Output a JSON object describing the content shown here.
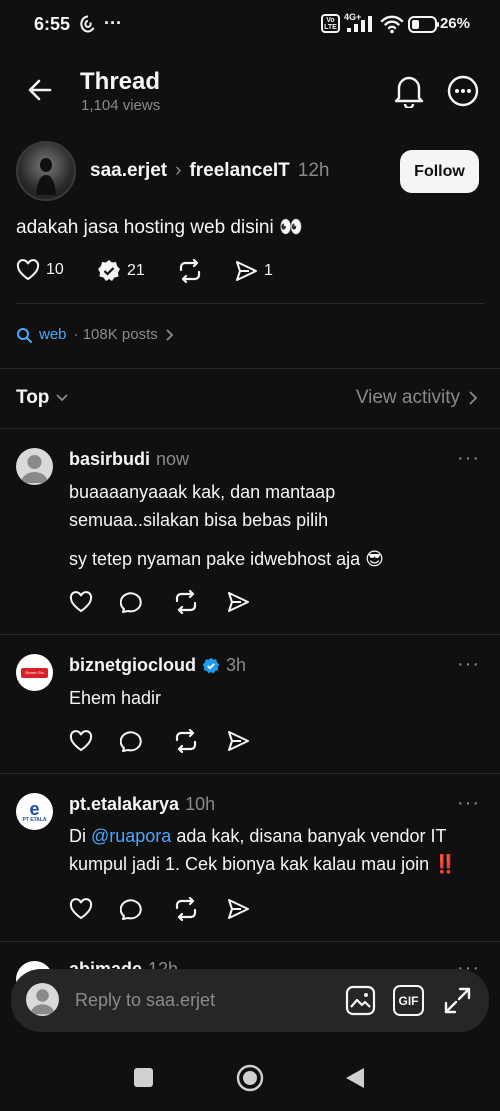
{
  "status_bar": {
    "time": "6:55",
    "network": "4G+",
    "battery": "26%"
  },
  "header": {
    "title": "Thread",
    "views": "1,104 views"
  },
  "post": {
    "author": "saa.erjet",
    "separator": "›",
    "topic": "freelanceIT",
    "time": "12h",
    "follow_label": "Follow",
    "text": "adakah jasa hosting web disini 👀",
    "likes": "10",
    "replies": "21",
    "shares": "1"
  },
  "topic_tag": {
    "name": "web",
    "posts": "· 108K posts"
  },
  "sort": {
    "label": "Top",
    "view_activity": "View activity"
  },
  "replies": [
    {
      "username": "basirbudi",
      "time": "now",
      "lines": [
        "buaaaanyaaak kak, dan mantaap",
        "semuaa..silakan bisa bebas pilih"
      ],
      "line2": "sy tetep nyaman pake idwebhost aja 😎"
    },
    {
      "username": "biznetgiocloud",
      "time": "3h",
      "verified": true,
      "text": "Ehem hadir",
      "avatar_text": "Biznet Gio Cloud"
    },
    {
      "username": "pt.etalakarya",
      "time": "10h",
      "text_prefix": "Di ",
      "mention": "@ruapora",
      "text_suffix": " ada kak, disana banyak vendor IT",
      "line2": "kumpul jadi 1. Cek bionya kak kalau mau join ‼️",
      "avatar_text": "PT ETALA"
    }
  ],
  "partial_reply": {
    "username": "abimade",
    "time": "12h"
  },
  "reply_bar": {
    "placeholder": "Reply to saa.erjet",
    "gif_label": "GIF"
  },
  "colors": {
    "background": "#101010",
    "accent_blue": "#4aa6ff",
    "muted": "#8a8a8a"
  }
}
